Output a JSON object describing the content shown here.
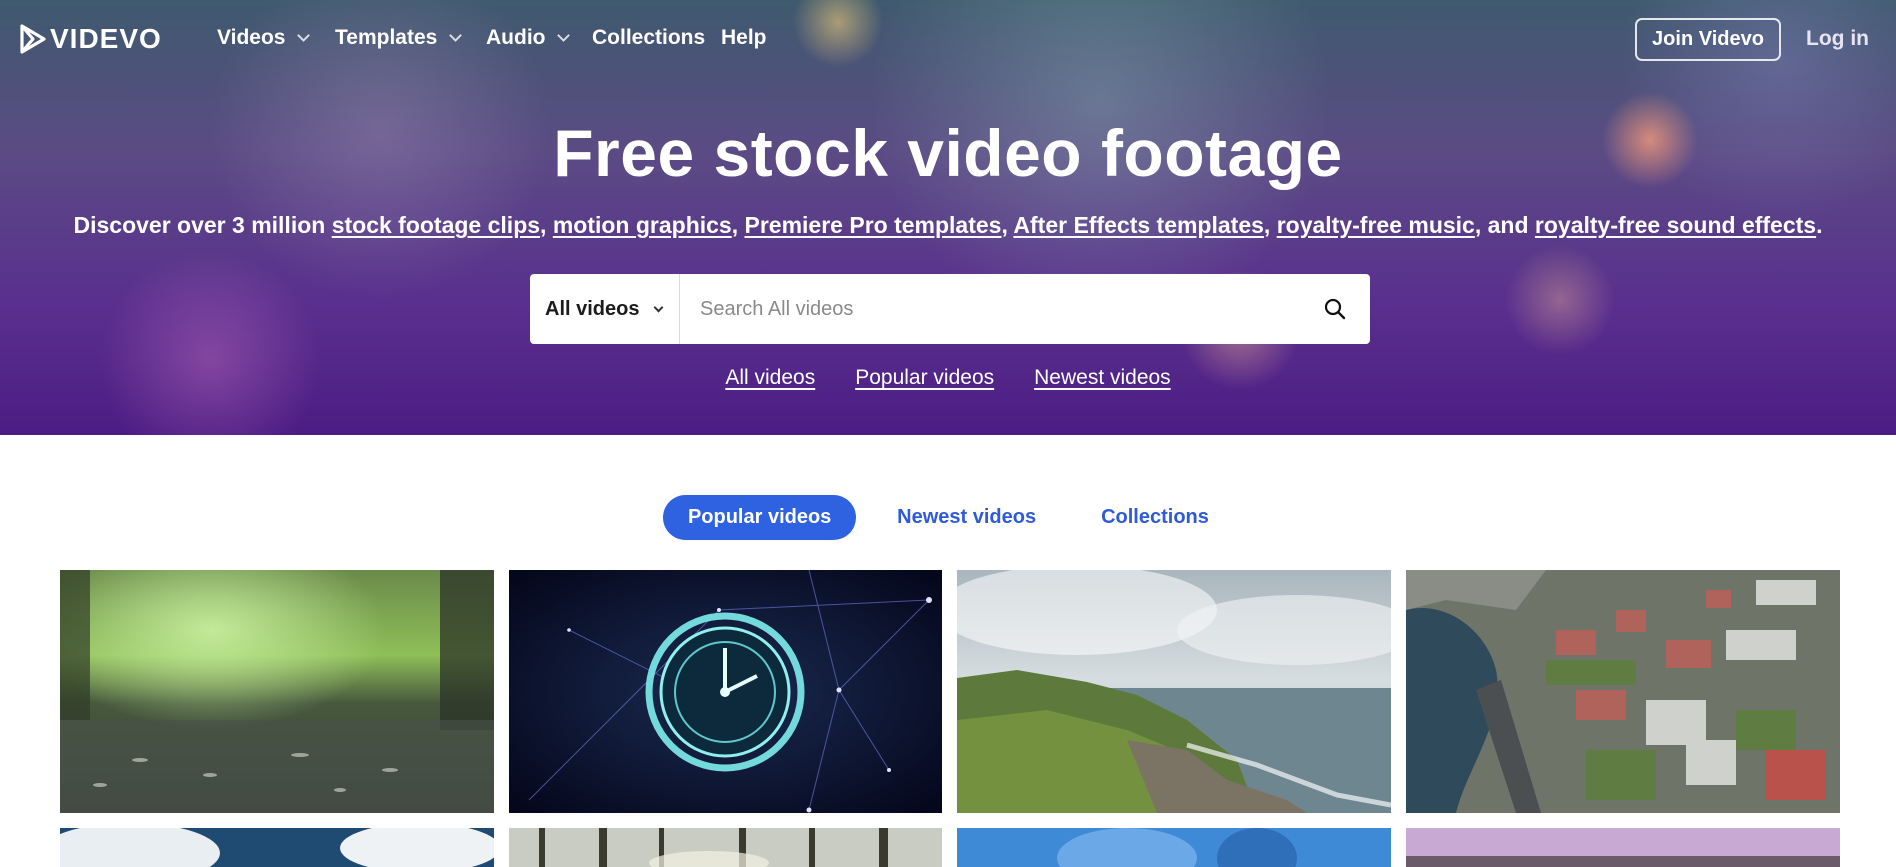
{
  "brand": {
    "name": "VIDEVO",
    "logo_icon": "videvo-play-logo"
  },
  "nav": {
    "items": [
      {
        "label": "Videos",
        "dropdown": true
      },
      {
        "label": "Templates",
        "dropdown": true
      },
      {
        "label": "Audio",
        "dropdown": true
      },
      {
        "label": "Collections",
        "dropdown": false
      },
      {
        "label": "Help",
        "dropdown": false
      }
    ],
    "join_label": "Join Videvo",
    "login_label": "Log in"
  },
  "hero": {
    "title": "Free stock video footage",
    "subtitle": {
      "prefix": "Discover over 3 million ",
      "links": [
        "stock footage clips",
        "motion graphics",
        "Premiere Pro templates",
        "After Effects templates",
        "royalty-free music",
        "royalty-free sound effects"
      ],
      "separator": ", ",
      "and_text": ", and ",
      "suffix": "."
    }
  },
  "search": {
    "category": "All videos",
    "placeholder": "Search All videos",
    "icon": "search-icon"
  },
  "quick_links": [
    "All videos",
    "Popular videos",
    "Newest videos"
  ],
  "tabs": [
    {
      "label": "Popular videos",
      "active": true
    },
    {
      "label": "Newest videos",
      "active": false
    },
    {
      "label": "Collections",
      "active": false
    }
  ],
  "colors": {
    "accent": "#2f62e0",
    "tab_text": "#2f5bd7"
  },
  "videos": [
    {
      "thumb": "rain-puddle-forest"
    },
    {
      "thumb": "clock-network-motion"
    },
    {
      "thumb": "coastal-cliffs"
    },
    {
      "thumb": "aerial-campus-river"
    },
    {
      "thumb": "sky-clouds"
    },
    {
      "thumb": "forest-trees"
    },
    {
      "thumb": "blue-abstract"
    },
    {
      "thumb": "purple-landscape"
    }
  ]
}
